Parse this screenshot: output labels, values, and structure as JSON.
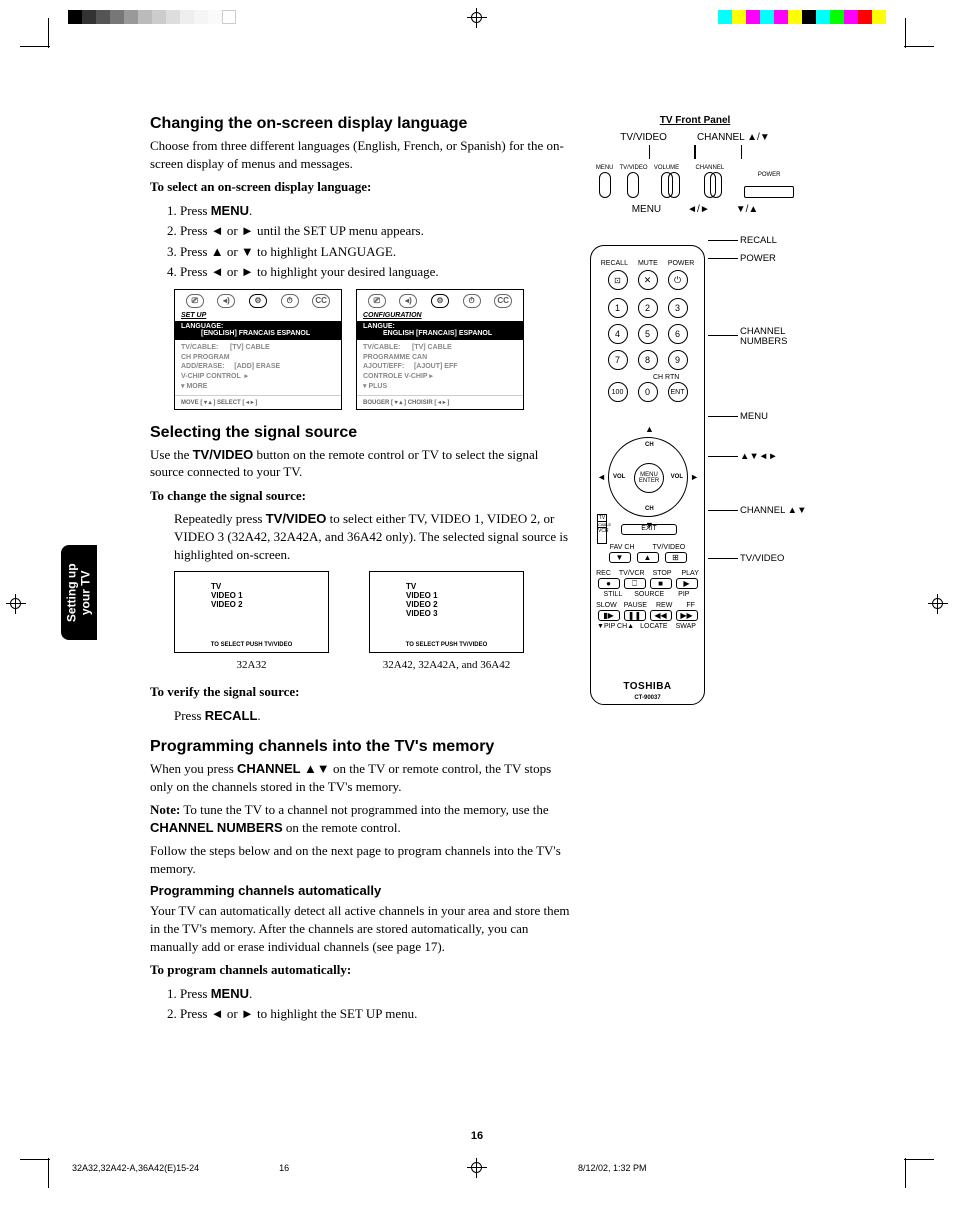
{
  "sideTab": {
    "line1": "Setting up",
    "line2": "your TV"
  },
  "sec1": {
    "heading": "Changing the on-screen display language",
    "intro": "Choose from three different languages (English, French, or Spanish) for the on-screen display of menus and messages.",
    "stepsTitle": "To select an on-screen display language:",
    "steps": {
      "s1a": "Press ",
      "s1b": "MENU",
      "s1c": ".",
      "s2a": "Press ",
      "s2arrL": "◄",
      "s2mid": " or ",
      "s2arrR": "►",
      "s2c": " until the SET UP menu appears.",
      "s3a": "Press ",
      "s3arrU": "▲",
      "s3mid": " or ",
      "s3arrD": "▼",
      "s3c": " to highlight LANGUAGE.",
      "s4a": "Press ",
      "s4arrL": "◄",
      "s4mid": " or ",
      "s4arrR": "►",
      "s4c": " to highlight your desired language."
    }
  },
  "osd1": {
    "title": "SET UP",
    "blackL1": "LANGUAGE:",
    "blackL2": "[ENGLISH] FRANCAIS ESPANOL",
    "body": "TV/CABLE:      [TV] CABLE\nCH PROGRAM\nADD/ERASE:     [ADD] ERASE\nV-CHIP CONTROL  ▸\n▾ MORE",
    "foot": "MOVE [ ▾ ▴ ]      SELECT [ ◂ ▸ ]"
  },
  "osd2": {
    "title": "CONFIGURATION",
    "blackL1": "LANGUE:",
    "blackL2": "ENGLISH [FRANCAIS] ESPANOL",
    "body": "TV/CABLE:      [TV] CABLE\nPROGRAMME CAN\nAJOUT/EFF:     [AJOUT] EFF\nCONTROLE V-CHIP ▸\n▾ PLUS",
    "foot": "BOUGER [ ▾ ▴ ]    CHOISIR [ ◂ ▸ ]"
  },
  "sec2": {
    "heading": "Selecting the signal source",
    "introA": "Use the ",
    "introB": "TV/VIDEO",
    "introC": " button on the remote control or TV to select the signal source connected to your TV.",
    "stepsTitle": "To change the signal source:",
    "bodyA": "Repeatedly press ",
    "bodyB": "TV/VIDEO",
    "bodyC": " to select either TV, VIDEO 1, VIDEO 2, or VIDEO 3 (32A42, 32A42A, and 36A42 only). The selected signal source is highlighted on-screen."
  },
  "sig1": {
    "l1": "TV",
    "l2": "VIDEO 1",
    "l3": "VIDEO 2",
    "foot": "TO SELECT PUSH TV/VIDEO",
    "cap": "32A32"
  },
  "sig2": {
    "l1": "TV",
    "l2": "VIDEO 1",
    "l3": "VIDEO 2",
    "l4": "VIDEO 3",
    "foot": "TO SELECT PUSH TV/VIDEO",
    "cap": "32A42, 32A42A, and 36A42"
  },
  "verify": {
    "title": "To verify the signal source:",
    "bodyA": "Press ",
    "bodyB": "RECALL",
    "bodyC": "."
  },
  "sec3": {
    "heading": "Programming channels into the TV's memory",
    "p1a": "When you press ",
    "p1b": "CHANNEL ▲▼",
    "p1c": " on the TV or remote control, the TV stops only on the channels stored in the TV's memory.",
    "p2a": "Note:",
    "p2b": " To tune the TV to a channel not programmed into the memory, use the ",
    "p2c": "CHANNEL NUMBERS",
    "p2d": " on the remote control.",
    "p3": "Follow the steps below and on the next page to program channels into the TV's memory.",
    "sub": "Programming channels automatically",
    "p4": "Your TV can automatically detect all active channels in your area and store them in the TV's memory. After the channels are stored automatically, you can manually add or erase individual channels (see page 17).",
    "stepsTitle": "To program channels automatically:",
    "s1a": "Press ",
    "s1b": "MENU",
    "s1c": ".",
    "s2a": "Press ",
    "s2arrL": "◄",
    "s2mid": " or ",
    "s2arrR": "►",
    "s2c": " to highlight the SET UP menu."
  },
  "frontPanel": {
    "title": "TV Front Panel",
    "top1": "TV/VIDEO",
    "top2": "CHANNEL ▲/▼",
    "b1": "MENU",
    "b2": "TV/VIDEO",
    "b3": "VOLUME",
    "b4": "CHANNEL",
    "b5": "POWER",
    "bot1": "MENU",
    "bot2": "◄/►",
    "bot3": "▼/▲"
  },
  "remote": {
    "recall": "RECALL",
    "mute": "MUTE",
    "power": "POWER",
    "n1": "1",
    "n2": "2",
    "n3": "3",
    "n4": "4",
    "n5": "5",
    "n6": "6",
    "n7": "7",
    "n8": "8",
    "n9": "9",
    "n0": "0",
    "n100": "100",
    "ent": "ENT",
    "chrtn": "CH RTN",
    "ch": "CH",
    "vol": "VOL",
    "menu": "MENU",
    "enter": "ENTER",
    "exit": "EXIT",
    "sw1": "TV",
    "sw2": "CABLE",
    "sw3": "VCR",
    "favch": "FAV CH",
    "tvvideo": "TV/VIDEO",
    "rec": "REC",
    "tvvcr": "TV/VCR",
    "stop": "STOP",
    "play": "PLAY",
    "still": "STILL",
    "source": "SOURCE",
    "pip": "PIP",
    "slow": "SLOW",
    "pause": "PAUSE",
    "rew": "REW",
    "ff": "FF",
    "pipch": "▼PIP CH▲",
    "locate": "LOCATE",
    "swap": "SWAP",
    "brand": "TOSHIBA",
    "model": "CT-90037"
  },
  "callouts": {
    "recall": "RECALL",
    "power": "POWER",
    "chnum": "CHANNEL\nNUMBERS",
    "menu": "MENU",
    "arrows": "▲▼◄►",
    "chanud": "CHANNEL ▲▼",
    "tvvideo": "TV/VIDEO"
  },
  "pageNum": "16",
  "footer": {
    "left": "32A32,32A42-A,36A42(E)15-24",
    "mid": "16",
    "right": "8/12/02, 1:32 PM"
  }
}
